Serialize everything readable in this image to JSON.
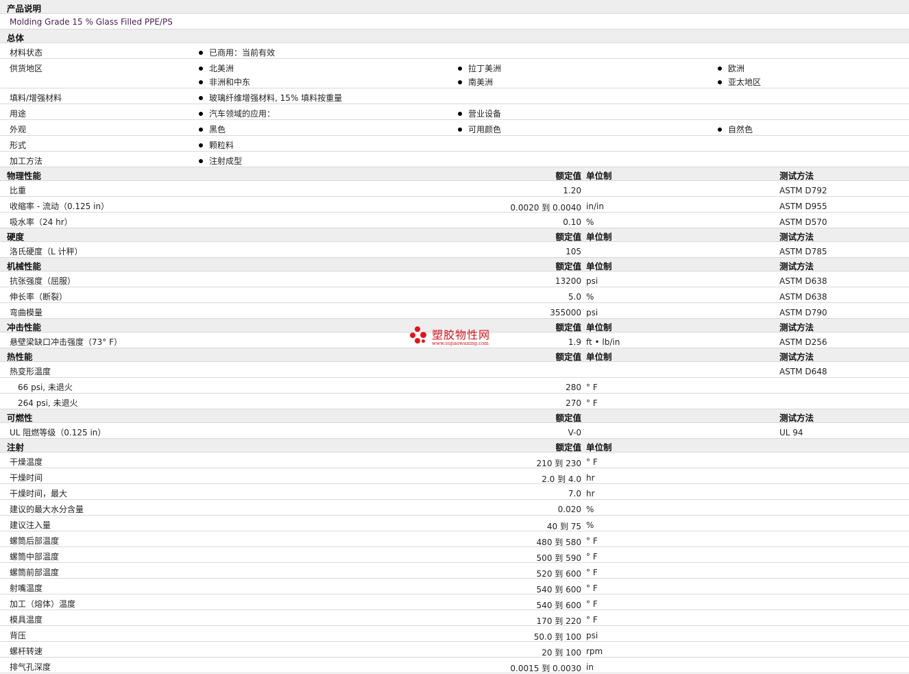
{
  "product": {
    "heading": "产品说明",
    "description": "Molding Grade 15 % Glass Filled PPE/PS"
  },
  "general": {
    "heading": "总体",
    "rows": [
      {
        "label": "材料状态",
        "items": [
          [
            "已商用：当前有效"
          ]
        ]
      },
      {
        "label": "供货地区",
        "items": [
          [
            "北美洲",
            "拉丁美洲",
            "欧洲"
          ],
          [
            "非洲和中东",
            "南美洲",
            "亚太地区"
          ]
        ]
      },
      {
        "label": "填料/增强材料",
        "items": [
          [
            "玻璃纤维增强材料, 15% 填料按重量"
          ]
        ]
      },
      {
        "label": "用途",
        "items": [
          [
            "汽车领域的应用：",
            "营业设备"
          ]
        ]
      },
      {
        "label": "外观",
        "items": [
          [
            "黑色",
            "可用颜色",
            "自然色"
          ]
        ]
      },
      {
        "label": "形式",
        "items": [
          [
            "颗粒料"
          ]
        ]
      },
      {
        "label": "加工方法",
        "items": [
          [
            "注射成型"
          ]
        ]
      }
    ]
  },
  "headers": {
    "rated": "额定值",
    "unit": "单位制",
    "test": "测试方法"
  },
  "sections": [
    {
      "title": "物理性能",
      "cols": [
        "rated",
        "unit",
        "test"
      ],
      "rows": [
        {
          "label": "比重",
          "value": "1.20",
          "unit": "",
          "test": "ASTM D792"
        },
        {
          "label": "收缩率 - 流动（0.125 in）",
          "value": "0.0020 到  0.0040",
          "unit": "in/in",
          "test": "ASTM D955"
        },
        {
          "label": "吸水率（24 hr）",
          "value": "0.10",
          "unit": "%",
          "test": "ASTM D570"
        }
      ]
    },
    {
      "title": "硬度",
      "cols": [
        "rated",
        "unit",
        "test"
      ],
      "rows": [
        {
          "label": "洛氏硬度（L 计秤）",
          "value": "105",
          "unit": "",
          "test": "ASTM D785"
        }
      ]
    },
    {
      "title": "机械性能",
      "cols": [
        "rated",
        "unit",
        "test"
      ],
      "rows": [
        {
          "label": "抗张强度（屈服）",
          "value": "13200",
          "unit": "psi",
          "test": "ASTM D638"
        },
        {
          "label": "伸长率（断裂）",
          "value": "5.0",
          "unit": "%",
          "test": "ASTM D638"
        },
        {
          "label": "弯曲模量",
          "value": "355000",
          "unit": "psi",
          "test": "ASTM D790"
        }
      ]
    },
    {
      "title": "冲击性能",
      "cols": [
        "rated",
        "unit",
        "test"
      ],
      "rows": [
        {
          "label": "悬壁梁缺口冲击强度（73° F）",
          "value": "1.9",
          "unit": "ft • lb/in",
          "test": "ASTM D256"
        }
      ]
    },
    {
      "title": "热性能",
      "cols": [
        "rated",
        "unit",
        "test"
      ],
      "rows": [
        {
          "label": "热变形温度",
          "value": "",
          "unit": "",
          "test": "ASTM D648"
        },
        {
          "label": "66 psi, 未退火",
          "sub": true,
          "value": "280",
          "unit": "° F",
          "test": ""
        },
        {
          "label": "264 psi, 未退火",
          "sub": true,
          "value": "270",
          "unit": "° F",
          "test": ""
        }
      ]
    },
    {
      "title": "可燃性",
      "cols": [
        "rated",
        "test"
      ],
      "rows": [
        {
          "label": "UL 阻燃等级（0.125 in）",
          "value": "V-0",
          "unit": "",
          "test": "UL 94"
        }
      ]
    },
    {
      "title": "注射",
      "cols": [
        "rated",
        "unit"
      ],
      "rows": [
        {
          "label": "干燥温度",
          "value": "210 到  230",
          "unit": "° F",
          "test": ""
        },
        {
          "label": "干燥时间",
          "value": "2.0 到  4.0",
          "unit": "hr",
          "test": ""
        },
        {
          "label": "干燥时间，最大",
          "value": "7.0",
          "unit": "hr",
          "test": ""
        },
        {
          "label": "建议的最大水分含量",
          "value": "0.020",
          "unit": "%",
          "test": ""
        },
        {
          "label": "建议注入量",
          "value": "40 到  75",
          "unit": "%",
          "test": ""
        },
        {
          "label": "螺筒后部温度",
          "value": "480 到  580",
          "unit": "° F",
          "test": ""
        },
        {
          "label": "螺筒中部温度",
          "value": "500 到  590",
          "unit": "° F",
          "test": ""
        },
        {
          "label": "螺筒前部温度",
          "value": "520 到  600",
          "unit": "° F",
          "test": ""
        },
        {
          "label": "射嘴温度",
          "value": "540 到  600",
          "unit": "° F",
          "test": ""
        },
        {
          "label": "加工（熔体）温度",
          "value": "540 到  600",
          "unit": "° F",
          "test": ""
        },
        {
          "label": "模具温度",
          "value": "170 到  220",
          "unit": "° F",
          "test": ""
        },
        {
          "label": "背压",
          "value": "50.0 到  100",
          "unit": "psi",
          "test": ""
        },
        {
          "label": "螺杆转速",
          "value": "20 到  100",
          "unit": "rpm",
          "test": ""
        },
        {
          "label": "排气孔深度",
          "value": "0.0015 到  0.0030",
          "unit": "in",
          "test": ""
        }
      ]
    }
  ],
  "watermark": {
    "name": "塑胶物性网",
    "url": "www.sujiaowuxing.com"
  },
  "colors": {
    "section_bg": "#eeeeee",
    "description_text": "#4b1d52",
    "watermark": "#e0151b"
  }
}
